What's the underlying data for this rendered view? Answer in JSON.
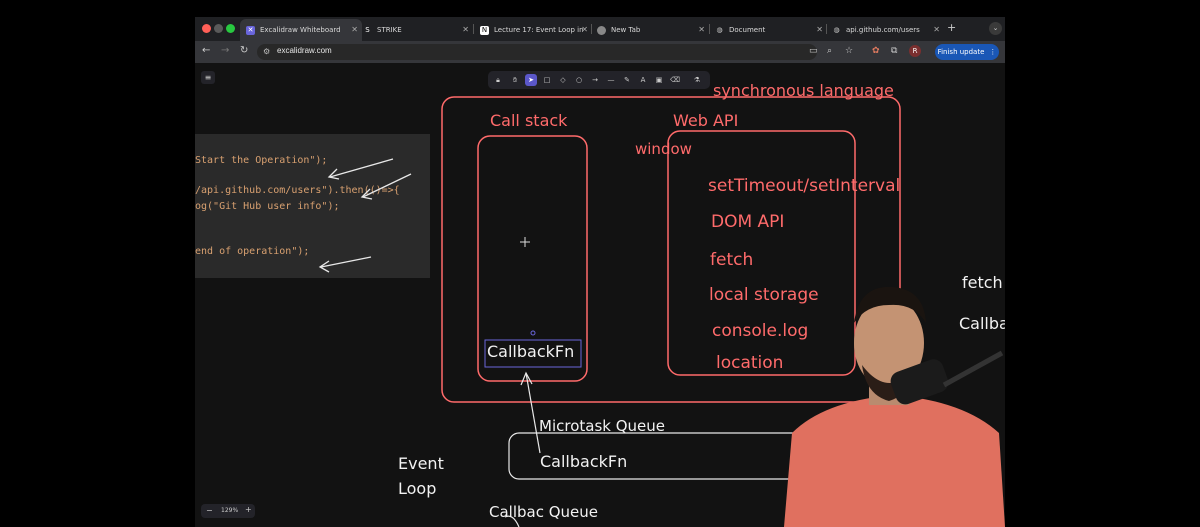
{
  "browser": {
    "tabs": [
      {
        "label": "Excalidraw Whiteboard",
        "icon": "excalidraw-icon",
        "active": true
      },
      {
        "label": "STRIKE",
        "icon": "strike-icon"
      },
      {
        "label": "Lecture 17: Event Loop in",
        "icon": "notion-icon"
      },
      {
        "label": "New Tab",
        "icon": "chrome-icon"
      },
      {
        "label": "Document",
        "icon": "globe-icon"
      },
      {
        "label": "api.github.com/users",
        "icon": "globe-icon"
      }
    ],
    "new_tab": "+",
    "url": "excalidraw.com",
    "profile_initial": "R",
    "finish_update": "Finish update"
  },
  "code_lines": [
    "Start the Operation\");",
    "/api.github.com/users\").then(()=>{",
    "og(\"Git Hub user info\");",
    "end of operation\");"
  ],
  "diagram": {
    "title_partial": "synchronous language",
    "call_stack": "Call stack",
    "web_api": "Web API",
    "window": "window",
    "web_api_items": [
      "setTimeout/setInterval",
      "DOM API",
      "fetch",
      "local storage",
      "console.log",
      "location"
    ],
    "stack_item": "CallbackFn",
    "microtask_queue": "Microtask Queue",
    "microtask_item": "CallbackFn",
    "event_loop": [
      "Event",
      "Loop"
    ],
    "callback_queue": "Callbac Queue",
    "right_fetch": "fetch",
    "right_callback": "Callba"
  },
  "zoom": {
    "minus": "−",
    "value": "129%",
    "plus": "+"
  },
  "colors": {
    "accent_red": "#ff6b6b",
    "update_blue": "#1a57b6"
  }
}
